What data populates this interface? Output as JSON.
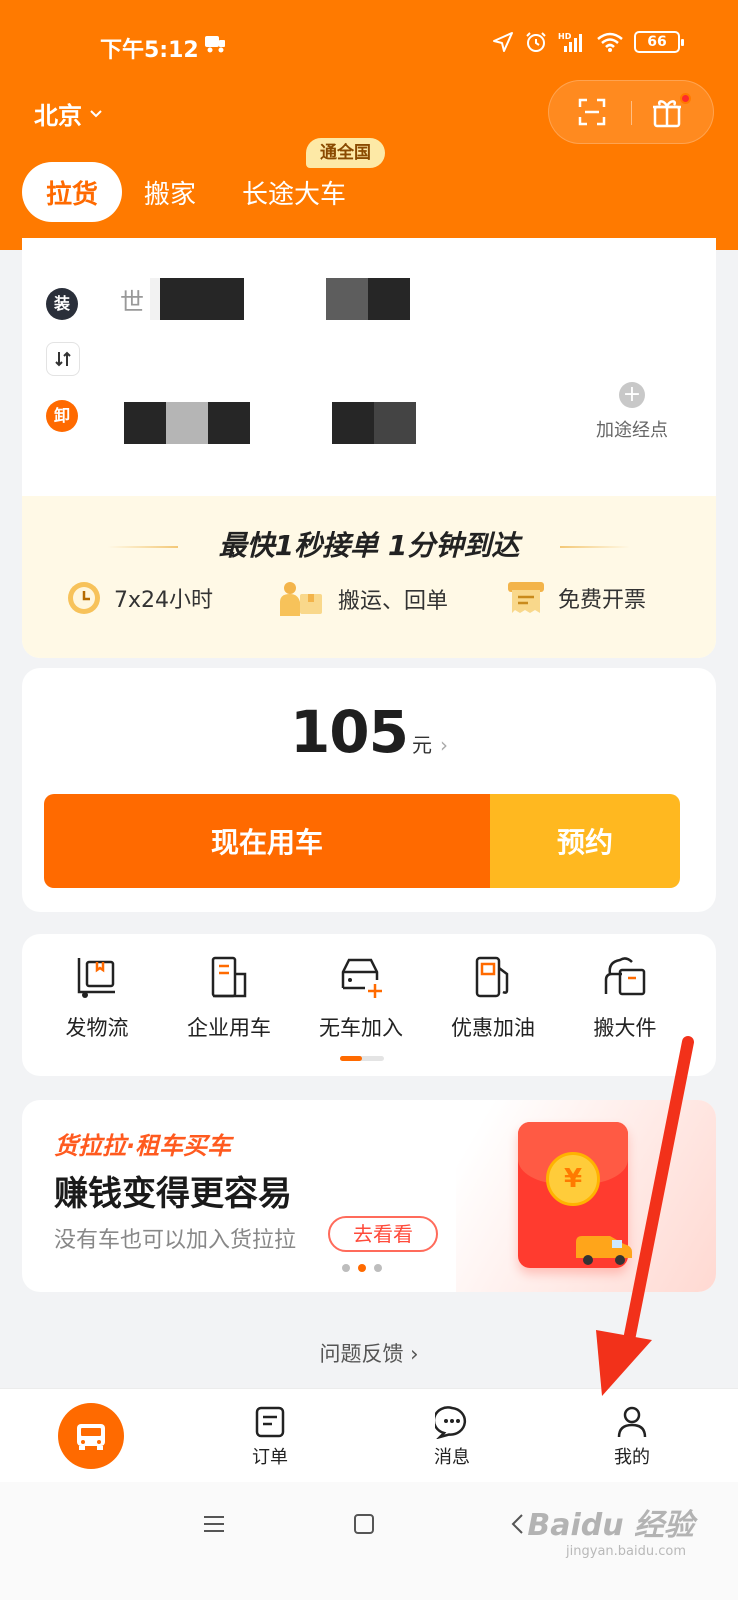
{
  "status_bar": {
    "time": "下午5:12",
    "network": "HD",
    "battery": "66"
  },
  "header": {
    "city": "北京",
    "tabs": [
      {
        "label": "拉货",
        "active": true
      },
      {
        "label": "搬家",
        "active": false
      },
      {
        "label": "长途大车",
        "active": false,
        "badge": "通全国"
      }
    ]
  },
  "address": {
    "load_marker": "装",
    "unload_marker": "卸",
    "load_text": "世",
    "via_label": "加途经点"
  },
  "promo": {
    "headline": "最快1秒接单 1分钟到达",
    "features": [
      {
        "icon": "clock-icon",
        "label": "7x24小时"
      },
      {
        "icon": "worker-box-icon",
        "label": "搬运、回单"
      },
      {
        "icon": "invoice-icon",
        "label": "免费开票"
      }
    ]
  },
  "order": {
    "price": "105",
    "unit": "元",
    "use_now_label": "现在用车",
    "book_label": "预约"
  },
  "services": [
    {
      "icon": "logistics-icon",
      "label": "发物流"
    },
    {
      "icon": "enterprise-icon",
      "label": "企业用车"
    },
    {
      "icon": "join-icon",
      "label": "无车加入"
    },
    {
      "icon": "fuel-icon",
      "label": "优惠加油"
    },
    {
      "icon": "large-item-icon",
      "label": "搬大件"
    }
  ],
  "banner": {
    "brand": "货拉拉·租车买车",
    "title": "赚钱变得更容易",
    "subtitle": "没有车也可以加入货拉拉",
    "button": "去看看",
    "coin_symbol": "¥"
  },
  "feedback": "问题反馈",
  "bottom_nav": [
    {
      "label": "订单"
    },
    {
      "label": "消息"
    },
    {
      "label": "我的"
    }
  ],
  "watermark": {
    "main": "Baidu 经验",
    "sub": "jingyan.baidu.com"
  },
  "colors": {
    "brand": "#ff7a00",
    "primary_button": "#ff6a00",
    "secondary_button": "#ffb820",
    "annotation": "#f2311a"
  }
}
